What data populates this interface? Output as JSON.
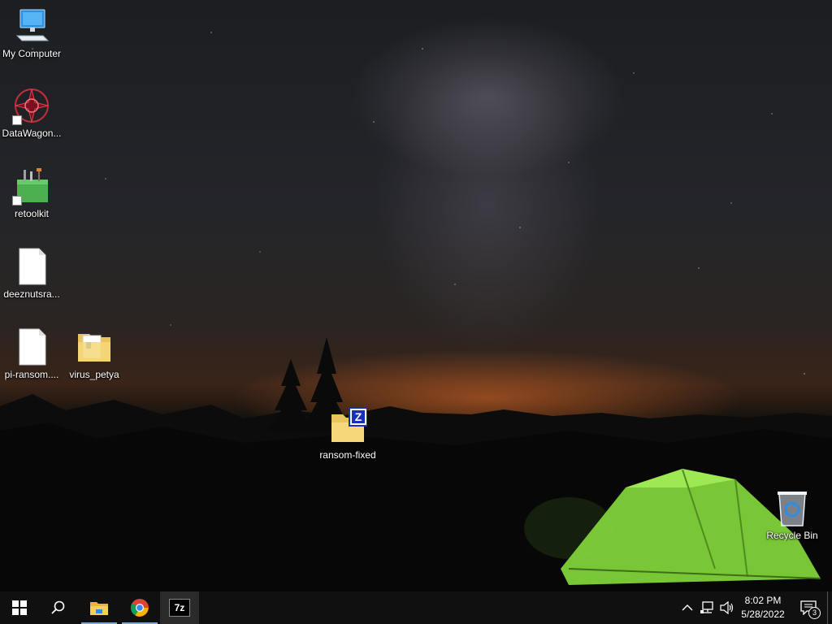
{
  "desktop": {
    "icons": [
      {
        "label": "My Computer",
        "icon": "computer-icon"
      },
      {
        "label": "DataWagon...",
        "icon": "datawagon-icon"
      },
      {
        "label": "retoolkit",
        "icon": "toolkit-icon"
      },
      {
        "label": "deeznutsra...",
        "icon": "blank-file-icon"
      },
      {
        "label": "pi-ransom....",
        "icon": "blank-file-icon"
      },
      {
        "label": "virus_petya",
        "icon": "folder-icon"
      },
      {
        "label": "ransom-fixed",
        "icon": "zip-folder-icon"
      },
      {
        "label": "Recycle Bin",
        "icon": "recycle-bin-icon"
      }
    ]
  },
  "taskbar": {
    "start": {
      "icon": "windows-logo-icon"
    },
    "search": {
      "icon": "search-icon"
    },
    "apps": [
      {
        "name": "File Explorer",
        "icon": "file-explorer-icon"
      },
      {
        "name": "Google Chrome",
        "icon": "chrome-icon"
      },
      {
        "name": "7-Zip",
        "icon": "7zip-icon",
        "icon_text": "7z"
      }
    ],
    "tray": {
      "icons": [
        "chevron-up-icon",
        "network-icon",
        "volume-icon"
      ],
      "time": "8:02 PM",
      "date": "5/28/2022",
      "notification_count": "3"
    }
  },
  "colors": {
    "taskbar_bg": "#101010",
    "running_indicator": "#7aa7d8",
    "active_indicator": "#4cc24c",
    "tent_green": "#7fd23a",
    "horizon_orange": "#e0692a"
  }
}
